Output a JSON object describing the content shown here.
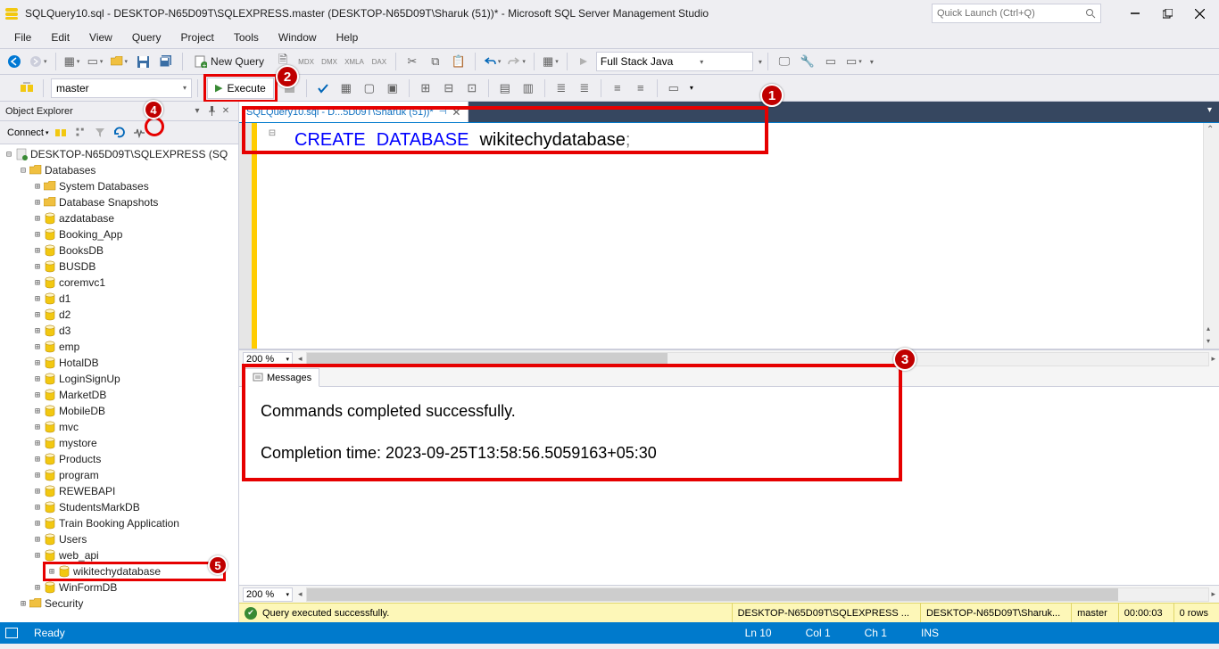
{
  "title": "SQLQuery10.sql - DESKTOP-N65D09T\\SQLEXPRESS.master (DESKTOP-N65D09T\\Sharuk (51))* - Microsoft SQL Server Management Studio",
  "quick_launch": {
    "placeholder": "Quick Launch (Ctrl+Q)"
  },
  "menu": {
    "file": "File",
    "edit": "Edit",
    "view": "View",
    "query": "Query",
    "project": "Project",
    "tools": "Tools",
    "window": "Window",
    "help": "Help"
  },
  "toolbar1": {
    "new_query": "New Query",
    "type_combo": "Full Stack Java"
  },
  "toolbar2": {
    "db_combo": "master",
    "execute": "Execute"
  },
  "object_explorer": {
    "title": "Object Explorer",
    "connect": "Connect",
    "server": "DESKTOP-N65D09T\\SQLEXPRESS (SQ",
    "databases_folder": "Databases",
    "sys_db": "System Databases",
    "snapshots": "Database Snapshots",
    "dbs": [
      "azdatabase",
      "Booking_App",
      "BooksDB",
      "BUSDB",
      "coremvc1",
      "d1",
      "d2",
      "d3",
      "emp",
      "HotalDB",
      "LoginSignUp",
      "MarketDB",
      "MobileDB",
      "mvc",
      "mystore",
      "Products",
      "program",
      "REWEBAPI",
      "StudentsMarkDB",
      "Train Booking Application",
      "Users",
      "web_api",
      "wikitechydatabase",
      "WinFormDB"
    ],
    "security": "Security"
  },
  "tab": {
    "label": "SQLQuery10.sql - D...5D09T\\Sharuk (51))*"
  },
  "code": {
    "kw1": "CREATE",
    "kw2": "DATABASE",
    "ident": "wikitechydatabase",
    "semi": ";"
  },
  "zoom": "200 %",
  "messages": {
    "tab": "Messages",
    "line1": "Commands completed successfully.",
    "line2": "Completion time: 2023-09-25T13:58:56.5059163+05:30"
  },
  "query_status": {
    "text": "Query executed successfully.",
    "server": "DESKTOP-N65D09T\\SQLEXPRESS ...",
    "user": "DESKTOP-N65D09T\\Sharuk...",
    "db": "master",
    "time": "00:00:03",
    "rows": "0 rows"
  },
  "statusbar": {
    "ready": "Ready",
    "ln": "Ln 10",
    "col": "Col 1",
    "ch": "Ch 1",
    "ins": "INS"
  },
  "badges": {
    "b1": "1",
    "b2": "2",
    "b3": "3",
    "b4": "4",
    "b5": "5"
  }
}
